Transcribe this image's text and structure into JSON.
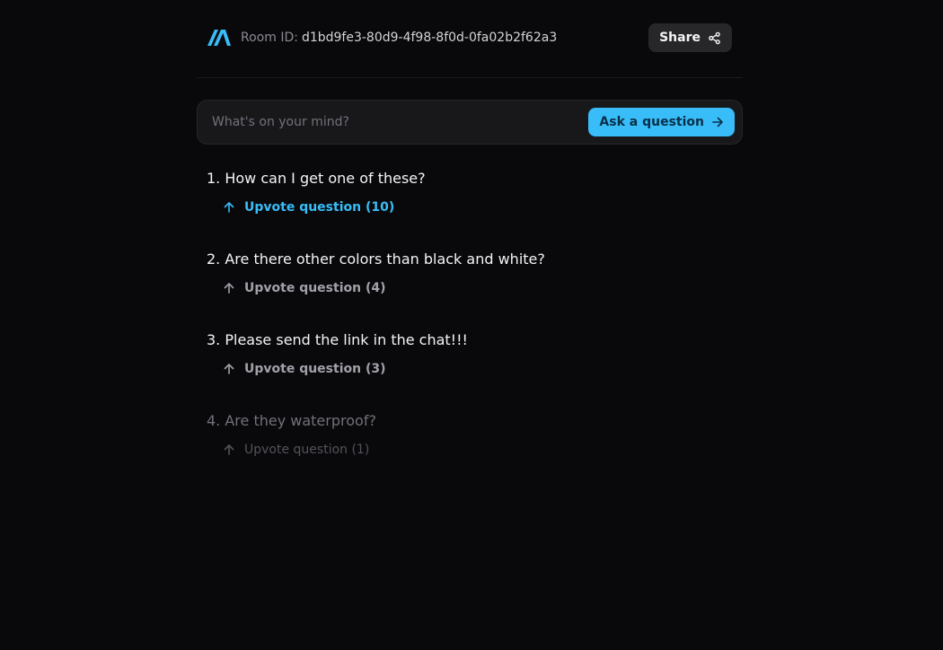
{
  "header": {
    "room_label": "Room ID:",
    "room_id": "d1bd9fe3-80d9-4f98-8f0d-0fa02b2f62a3",
    "share_label": "Share",
    "logo_icon": "logo-icon",
    "share_icon": "share-icon"
  },
  "ask": {
    "placeholder": "What's on your mind?",
    "value": "",
    "button_label": "Ask a question",
    "button_icon": "arrow-right-icon"
  },
  "questions": [
    {
      "text": "1. How can I get one of these?",
      "upvote_label": "Upvote question (10)",
      "state": "upvoted"
    },
    {
      "text": "2. Are there other colors than black and white?",
      "upvote_label": "Upvote question (4)",
      "state": "default"
    },
    {
      "text": "3. Please send the link in the chat!!!",
      "upvote_label": "Upvote question (3)",
      "state": "default"
    },
    {
      "text": "4. Are they waterproof?",
      "upvote_label": "Upvote question (1)",
      "state": "answered"
    }
  ],
  "colors": {
    "background": "#09090b",
    "accent": "#38bdf8",
    "surface": "#18181b",
    "muted_text": "#a1a1aa"
  }
}
